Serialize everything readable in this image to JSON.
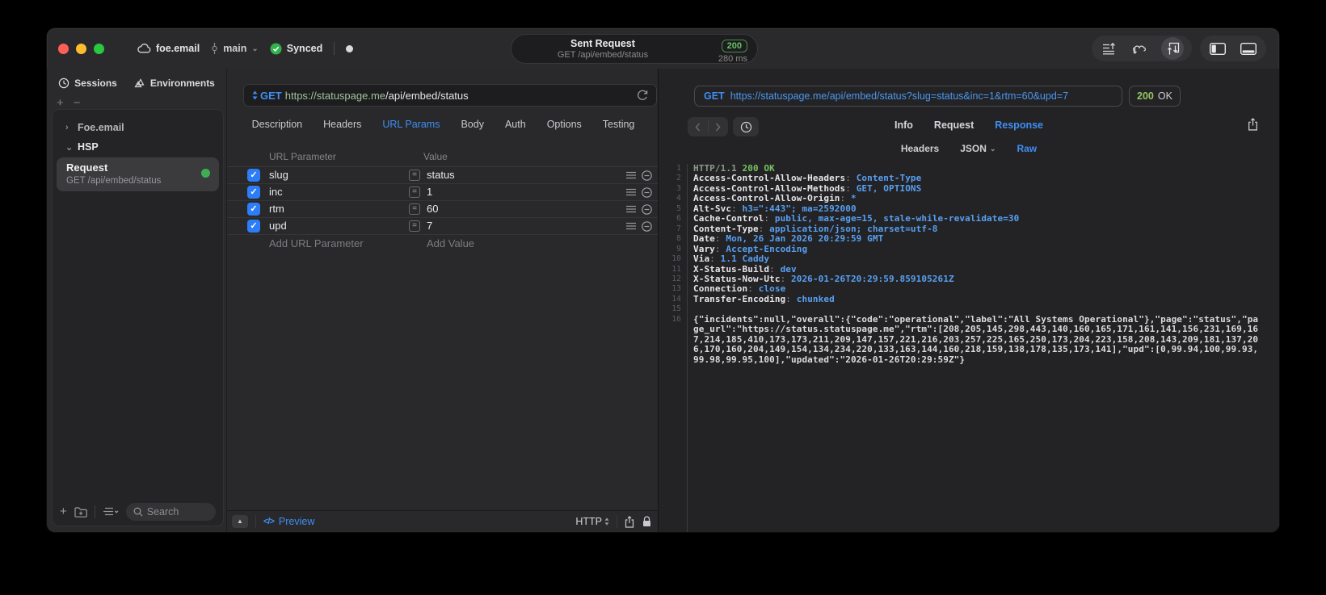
{
  "colors": {
    "accent_blue": "#3f8ef3",
    "url_host_green": "#9fc39a",
    "response_url_blue": "#4b97f0",
    "code_value_blue": "#57a0f2",
    "code_ok_green": "#77c35e",
    "badge_green": "#67c467",
    "checkbox_blue": "#2c7ef8",
    "status_dot_green": "#3fae53"
  },
  "icons": {
    "chevron_right": "›",
    "chevron_down": "⌄",
    "check": "✓",
    "plus": "+",
    "minus": "−",
    "equals": "=",
    "triangle_up": "▲",
    "code_glyph": "</>"
  },
  "titlebar": {
    "cloud_label": "foe.email",
    "branch": "main",
    "sync_status": "Synced",
    "request_pill": {
      "title": "Sent Request",
      "subtitle": "GET /api/embed/status",
      "status_code": "200",
      "duration": "280 ms"
    }
  },
  "sidebar": {
    "tabs": [
      {
        "label": "Sessions"
      },
      {
        "label": "Environments"
      }
    ],
    "tree": [
      {
        "label": "Foe.email",
        "expanded": false
      },
      {
        "label": "HSP",
        "expanded": true
      }
    ],
    "request_item": {
      "title": "Request",
      "subtitle": "GET /api/embed/status"
    },
    "search_placeholder": "Search"
  },
  "request_panel": {
    "method": "GET",
    "url_host": "https://statuspage.me",
    "url_path": "/api/embed/status",
    "tabs": [
      {
        "label": "Description"
      },
      {
        "label": "Headers"
      },
      {
        "label": "URL Params",
        "active": true
      },
      {
        "label": "Body"
      },
      {
        "label": "Auth"
      },
      {
        "label": "Options"
      },
      {
        "label": "Testing"
      }
    ],
    "params_table": {
      "columns": [
        "URL Parameter",
        "Value"
      ],
      "rows": [
        {
          "enabled": true,
          "name": "slug",
          "value": "status"
        },
        {
          "enabled": true,
          "name": "inc",
          "value": "1"
        },
        {
          "enabled": true,
          "name": "rtm",
          "value": "60"
        },
        {
          "enabled": true,
          "name": "upd",
          "value": "7"
        }
      ],
      "add_name_placeholder": "Add URL Parameter",
      "add_value_placeholder": "Add Value"
    },
    "footer": {
      "preview_label": "Preview",
      "protocol": "HTTP"
    }
  },
  "response_panel": {
    "method": "GET",
    "url": "https://statuspage.me/api/embed/status?slug=status&inc=1&rtm=60&upd=7",
    "status_code": "200",
    "status_text": "OK",
    "tabs": [
      {
        "label": "Info"
      },
      {
        "label": "Request"
      },
      {
        "label": "Response",
        "active": true
      }
    ],
    "subtabs": [
      {
        "label": "Headers"
      },
      {
        "label": "JSON",
        "has_chevron": true
      },
      {
        "label": "Raw",
        "active": true
      }
    ],
    "lines": [
      {
        "n": "1",
        "parts": [
          {
            "t": "HTTP/1.1 ",
            "c": "dim"
          },
          {
            "t": "200 OK",
            "c": "ok"
          }
        ]
      },
      {
        "n": "2",
        "parts": [
          {
            "t": "Access-Control-Allow-Headers",
            "c": "name"
          },
          {
            "t": ": ",
            "c": "sep"
          },
          {
            "t": "Content-Type",
            "c": "val"
          }
        ]
      },
      {
        "n": "3",
        "parts": [
          {
            "t": "Access-Control-Allow-Methods",
            "c": "name"
          },
          {
            "t": ": ",
            "c": "sep"
          },
          {
            "t": "GET, OPTIONS",
            "c": "val"
          }
        ]
      },
      {
        "n": "4",
        "parts": [
          {
            "t": "Access-Control-Allow-Origin",
            "c": "name"
          },
          {
            "t": ": ",
            "c": "sep"
          },
          {
            "t": "*",
            "c": "val"
          }
        ]
      },
      {
        "n": "5",
        "parts": [
          {
            "t": "Alt-Svc",
            "c": "name"
          },
          {
            "t": ": ",
            "c": "sep"
          },
          {
            "t": "h3=\":443\"; ma=2592000",
            "c": "val"
          }
        ]
      },
      {
        "n": "6",
        "parts": [
          {
            "t": "Cache-Control",
            "c": "name"
          },
          {
            "t": ": ",
            "c": "sep"
          },
          {
            "t": "public, max-age=15, stale-while-revalidate=30",
            "c": "val"
          }
        ]
      },
      {
        "n": "7",
        "parts": [
          {
            "t": "Content-Type",
            "c": "name"
          },
          {
            "t": ": ",
            "c": "sep"
          },
          {
            "t": "application/json; charset=utf-8",
            "c": "val"
          }
        ]
      },
      {
        "n": "8",
        "parts": [
          {
            "t": "Date",
            "c": "name"
          },
          {
            "t": ": ",
            "c": "sep"
          },
          {
            "t": "Mon, 26 Jan 2026 20:29:59 GMT",
            "c": "val"
          }
        ]
      },
      {
        "n": "9",
        "parts": [
          {
            "t": "Vary",
            "c": "name"
          },
          {
            "t": ": ",
            "c": "sep"
          },
          {
            "t": "Accept-Encoding",
            "c": "val"
          }
        ]
      },
      {
        "n": "10",
        "parts": [
          {
            "t": "Via",
            "c": "name"
          },
          {
            "t": ": ",
            "c": "sep"
          },
          {
            "t": "1.1 Caddy",
            "c": "val"
          }
        ]
      },
      {
        "n": "11",
        "parts": [
          {
            "t": "X-Status-Build",
            "c": "name"
          },
          {
            "t": ": ",
            "c": "sep"
          },
          {
            "t": "dev",
            "c": "val"
          }
        ]
      },
      {
        "n": "12",
        "parts": [
          {
            "t": "X-Status-Now-Utc",
            "c": "name"
          },
          {
            "t": ": ",
            "c": "sep"
          },
          {
            "t": "2026-01-26T20:29:59.859105261Z",
            "c": "val"
          }
        ]
      },
      {
        "n": "13",
        "parts": [
          {
            "t": "Connection",
            "c": "name"
          },
          {
            "t": ": ",
            "c": "sep"
          },
          {
            "t": "close",
            "c": "val"
          }
        ]
      },
      {
        "n": "14",
        "parts": [
          {
            "t": "Transfer-Encoding",
            "c": "name"
          },
          {
            "t": ": ",
            "c": "sep"
          },
          {
            "t": "chunked",
            "c": "val"
          }
        ]
      },
      {
        "n": "15",
        "parts": []
      },
      {
        "n": "16",
        "parts": [
          {
            "t": "{\"incidents\":null,\"overall\":{\"code\":\"operational\",\"label\":\"All Systems Operational\"},\"page\":\"status\",\"page_url\":\"https://status.statuspage.me\",\"rtm\":[208,205,145,298,443,140,160,165,171,161,141,156,231,169,167,214,185,410,173,173,211,209,147,157,221,216,203,257,225,165,250,173,204,223,158,208,143,209,181,137,206,170,160,204,149,154,134,234,220,133,163,144,160,218,159,138,178,135,173,141],\"upd\":[0,99.94,100,99.93,99.98,99.95,100],\"updated\":\"2026-01-26T20:29:59Z\"}",
            "c": "body"
          }
        ]
      }
    ]
  }
}
